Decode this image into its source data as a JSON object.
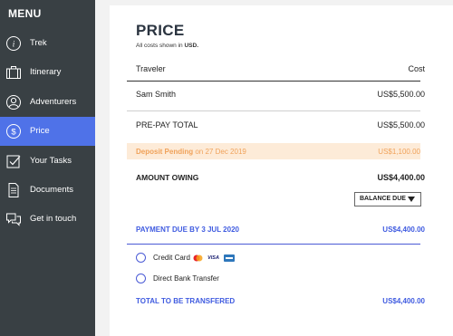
{
  "sidebar": {
    "title": "MENU",
    "items": [
      {
        "label": "Trek",
        "icon": "info-icon",
        "active": false
      },
      {
        "label": "Itinerary",
        "icon": "suitcase-icon",
        "active": false
      },
      {
        "label": "Adventurers",
        "icon": "person-icon",
        "active": false
      },
      {
        "label": "Price",
        "icon": "dollar-icon",
        "active": true
      },
      {
        "label": "Your Tasks",
        "icon": "checkbox-icon",
        "active": false
      },
      {
        "label": "Documents",
        "icon": "document-icon",
        "active": false
      },
      {
        "label": "Get in touch",
        "icon": "chat-icon",
        "active": false
      }
    ]
  },
  "price": {
    "title": "PRICE",
    "currency_note_prefix": "All costs shown in ",
    "currency_code": "USD.",
    "col_traveler": "Traveler",
    "col_cost": "Cost",
    "traveler_name": "Sam Smith",
    "traveler_cost": "US$5,500.00",
    "prepay_label": "PRE-PAY TOTAL",
    "prepay_cost": "US$5,500.00",
    "deposit_label": "Deposit Pending",
    "deposit_date": "on 27 Dec 2019",
    "deposit_amount": "US$1,100.00",
    "owing_label": "AMOUNT OWING",
    "owing_amount": "US$4,400.00",
    "balance_select": "BALANCE DUE",
    "payment_due_label": "PAYMENT DUE BY 3 JUL 2020",
    "payment_due_amount": "US$4,400.00",
    "method_credit_card": "Credit Card",
    "method_bank_transfer": "Direct Bank Transfer",
    "card_brands": [
      "mastercard-icon",
      "VISA",
      "amex-icon"
    ],
    "total_label": "TOTAL TO BE TRANSFERED",
    "total_amount": "US$4,400.00"
  },
  "colors": {
    "sidebar_bg": "#394044",
    "active_item": "#4f72e8",
    "accent_blue": "#3f5be0",
    "deposit_bg": "#fdebd8",
    "deposit_text": "#f0a25a"
  }
}
